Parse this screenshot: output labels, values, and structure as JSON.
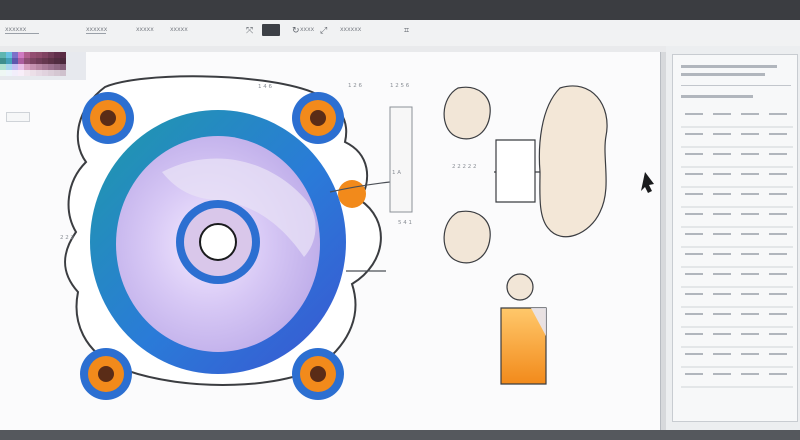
{
  "toolbar": {
    "labels": [
      "xxxxxx",
      "xxxxxx",
      "xxxxx",
      "xxxxx",
      "xxxx",
      "xxxxxx"
    ],
    "icon_names": [
      "move-icon",
      "rotate-icon",
      "scale-icon",
      "view-icon"
    ]
  },
  "canvas": {
    "labels": {
      "top_a": "1 4 6",
      "top_b": "1 2 6",
      "top_c": "1 2 5 6",
      "mid_a": "5 4 1",
      "mid_b": "1 A",
      "mid_c": "2 2 2 2 2",
      "left": "2 2 2"
    }
  },
  "colors": {
    "orange": "#f28a1b",
    "blue": "#2c6fd1",
    "teal": "#1f8a9b",
    "lavender": "#b8a6e6",
    "paper": "#fbfbfc",
    "chrome": "#3b3d41"
  }
}
